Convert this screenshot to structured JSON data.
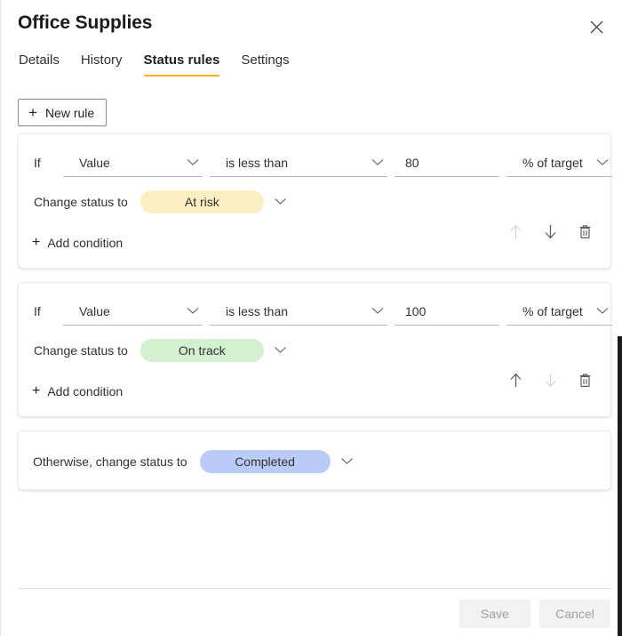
{
  "header": {
    "title": "Office Supplies",
    "close_icon": "close-icon"
  },
  "tabs": [
    {
      "label": "Details",
      "active": false
    },
    {
      "label": "History",
      "active": false
    },
    {
      "label": "Status rules",
      "active": true
    },
    {
      "label": "Settings",
      "active": false
    }
  ],
  "toolbar": {
    "new_rule_label": "New rule",
    "plus_glyph": "+"
  },
  "rules": [
    {
      "if_label": "If",
      "property": "Value",
      "operator": "is less than",
      "value": "80",
      "unit": "% of target",
      "status_label": "Change status to",
      "status_value": "At risk",
      "status_color": "#fbeec2",
      "add_condition_label": "Add condition",
      "move_up_enabled": false,
      "move_down_enabled": true
    },
    {
      "if_label": "If",
      "property": "Value",
      "operator": "is less than",
      "value": "100",
      "unit": "% of target",
      "status_label": "Change status to",
      "status_value": "On track",
      "status_color": "#d3f0d0",
      "add_condition_label": "Add condition",
      "move_up_enabled": true,
      "move_down_enabled": false
    }
  ],
  "otherwise": {
    "label": "Otherwise, change status to",
    "status_value": "Completed",
    "status_color": "#b9ccf7"
  },
  "footer": {
    "save_label": "Save",
    "cancel_label": "Cancel"
  },
  "colors": {
    "tab_accent": "#f2b01e",
    "scrollbar_thumb": "#1a1a1a"
  }
}
